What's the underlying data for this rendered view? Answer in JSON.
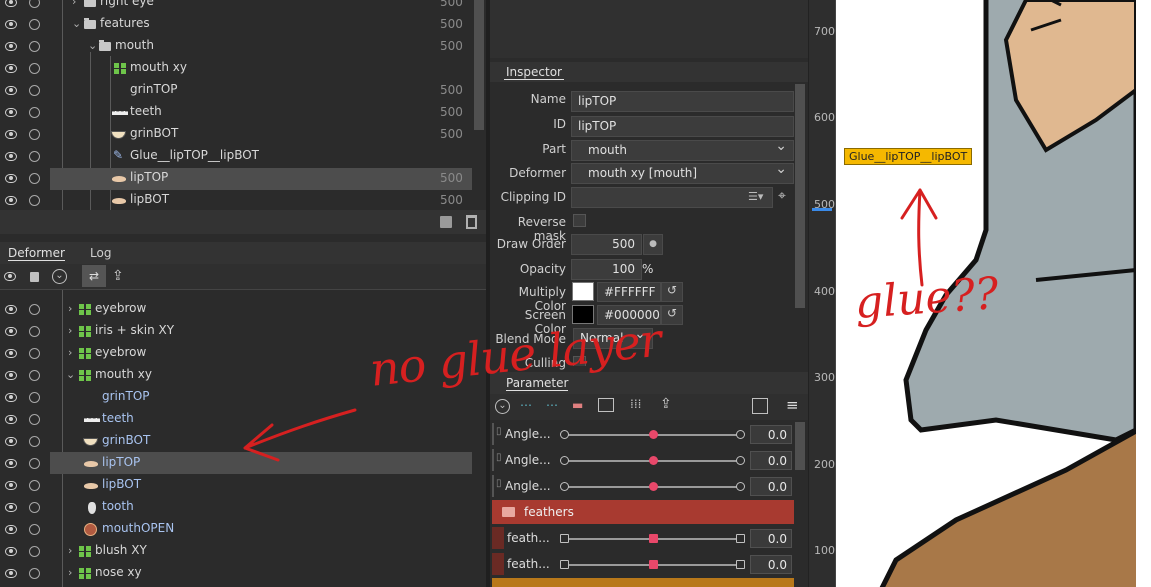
{
  "top_tree": {
    "rows": [
      {
        "label": "right eye",
        "value": "500"
      },
      {
        "label": "features",
        "value": "500"
      },
      {
        "label": "mouth",
        "value": "500"
      },
      {
        "label": "mouth xy",
        "value": ""
      },
      {
        "label": "grinTOP",
        "value": "500"
      },
      {
        "label": "teeth",
        "value": "500"
      },
      {
        "label": "grinBOT",
        "value": "500"
      },
      {
        "label": "Glue__lipTOP__lipBOT",
        "value": ""
      },
      {
        "label": "lipTOP",
        "value": "500"
      },
      {
        "label": "lipBOT",
        "value": "500"
      }
    ]
  },
  "deformer_panel": {
    "tabs": [
      "Deformer",
      "Log"
    ],
    "rows": [
      {
        "label": "eyebrow"
      },
      {
        "label": "iris + skin XY"
      },
      {
        "label": "eyebrow"
      },
      {
        "label": "mouth xy"
      },
      {
        "label": "grinTOP"
      },
      {
        "label": "teeth"
      },
      {
        "label": "grinBOT"
      },
      {
        "label": "lipTOP"
      },
      {
        "label": "lipBOT"
      },
      {
        "label": "tooth"
      },
      {
        "label": "mouthOPEN"
      },
      {
        "label": "blush XY"
      },
      {
        "label": "nose xy"
      }
    ]
  },
  "inspector": {
    "tab": "Inspector",
    "name_label": "Name",
    "name_value": "lipTOP",
    "id_label": "ID",
    "id_value": "lipTOP",
    "part_label": "Part",
    "part_value": "mouth",
    "deformer_label": "Deformer",
    "deformer_value": "mouth xy  [mouth]",
    "clipping_label": "Clipping ID",
    "clipping_value": "",
    "reverse_label": "Reverse mask",
    "draw_order_label": "Draw Order",
    "draw_order_value": "500",
    "opacity_label": "Opacity",
    "opacity_value": "100",
    "opacity_unit": "%",
    "multiply_label": "Multiply Color",
    "multiply_value": "#FFFFFF",
    "screen_label": "Screen Color",
    "screen_value": "#000000",
    "blend_label": "Blend Mode",
    "blend_value": "Normal",
    "culling_label": "Culling"
  },
  "parameter": {
    "tab": "Parameter",
    "rows": [
      {
        "label": "Angle...",
        "value": "0.0",
        "position": 0.5
      },
      {
        "label": "Angle...",
        "value": "0.0",
        "position": 0.5
      },
      {
        "label": "Angle...",
        "value": "0.0",
        "position": 0.5
      }
    ],
    "group_label": "feathers",
    "group_rows": [
      {
        "label": "feath...",
        "value": "0.0",
        "position": 0.5
      },
      {
        "label": "feath...",
        "value": "0.0",
        "position": 0.5
      }
    ]
  },
  "ruler": {
    "labels": [
      "700",
      "600",
      "500",
      "400",
      "300",
      "200",
      "100"
    ]
  },
  "canvas": {
    "tooltip": "Glue__lipTOP__lipBOT"
  },
  "annotations": {
    "left_note": "no glue layer",
    "right_note": "glue??"
  },
  "colors": {
    "accent_selected": "#4d4d4d",
    "param_knob": "#e8486a",
    "group_header": "#a83a30",
    "tooltip_bg": "#f5b800",
    "annotation": "#d62020"
  }
}
